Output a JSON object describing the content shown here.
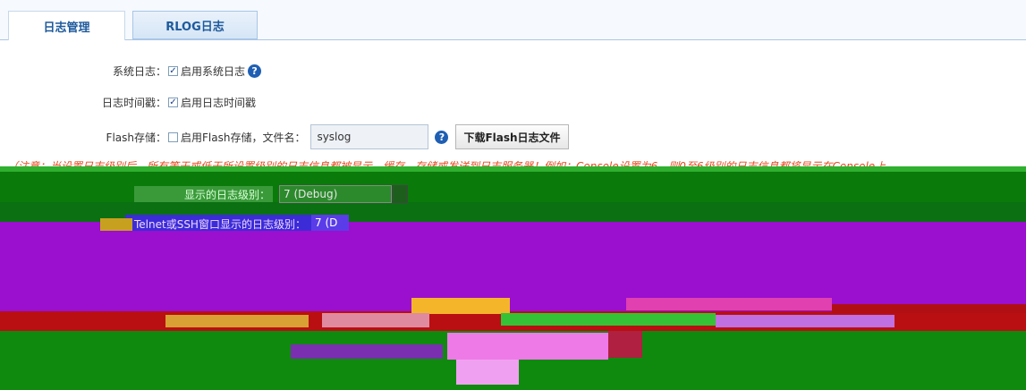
{
  "tabs": [
    {
      "label": "日志管理",
      "active": true
    },
    {
      "label": "RLOG日志",
      "active": false
    }
  ],
  "form": {
    "syslog": {
      "label": "系统日志：",
      "checkbox_label": "启用系统日志",
      "checked": true
    },
    "timestamp": {
      "label": "日志时间戳：",
      "checkbox_label": "启用日志时间戳",
      "checked": true
    },
    "flash": {
      "label": "Flash存储：",
      "checkbox_label": "启用Flash存储，文件名：",
      "checked": false,
      "filename_value": "syslog",
      "download_button": "下载Flash日志文件"
    }
  },
  "note": "（注意：当设置日志级别后，所有等于或低于所设置级别的日志信息都被显示、缓存、存储或发送到日志服务器！例如：Console设置为6，则0至6级别的日志信息都将显示在Console上",
  "console_level": {
    "label": "显示的日志级别：",
    "value": "7 (Debug)"
  },
  "ssh_level": {
    "label": "Telnet或SSH窗口显示的日志级别：",
    "value": "7 (D"
  },
  "colors": {
    "accent": "#1f5fb3",
    "warning": "#e24a1c",
    "tab_text": "#1e5a9c"
  },
  "icons": [
    "help-icon",
    "checkbox-icon"
  ]
}
